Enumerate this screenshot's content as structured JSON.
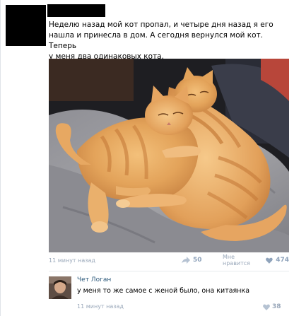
{
  "post": {
    "text": "Неделю назад мой кот пропал, и четыре дня назад я его\nнашла и принесла в дом. А сегодня вернулся мой кот. Теперь\nу меня два одинаковых кота.",
    "timestamp": "11 минут назад",
    "share_count": "50",
    "like_label": "Мне нравится",
    "like_count": "474",
    "icons": {
      "share": "share-icon",
      "like": "heart-icon"
    },
    "colors": {
      "link": "#2b587a",
      "muted": "#9aa8ba",
      "counter": "#8fa3bb"
    }
  },
  "comment": {
    "author": "Чет Логан",
    "text": "у меня то же самое с женой было, она китаянка",
    "timestamp": "11 минут назад",
    "like_count": "38"
  }
}
